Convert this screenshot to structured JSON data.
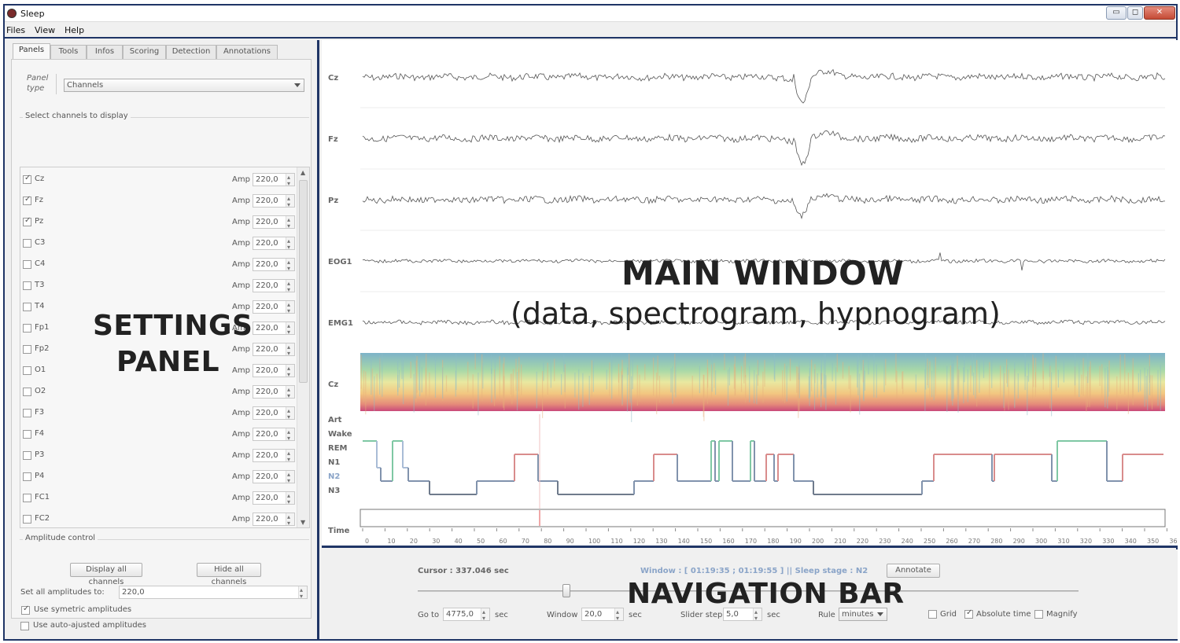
{
  "window": {
    "title": "Sleep",
    "buttons": {
      "minimize": "▭",
      "maximize": "◻",
      "close": "✕"
    }
  },
  "menu": [
    "Files",
    "View",
    "Help"
  ],
  "settings": {
    "tabs": [
      "Panels",
      "Tools",
      "Infos",
      "Scoring",
      "Detection",
      "Annotations"
    ],
    "panel_type_label_1": "Panel",
    "panel_type_label_2": "type",
    "panel_type_value": "Channels",
    "select_channels_title": "Select channels to display",
    "amp_label": "Amp",
    "channels": [
      {
        "name": "Cz",
        "checked": true,
        "amp": "220,0"
      },
      {
        "name": "Fz",
        "checked": true,
        "amp": "220,0"
      },
      {
        "name": "Pz",
        "checked": true,
        "amp": "220,0"
      },
      {
        "name": "C3",
        "checked": false,
        "amp": "220,0"
      },
      {
        "name": "C4",
        "checked": false,
        "amp": "220,0"
      },
      {
        "name": "T3",
        "checked": false,
        "amp": "220,0"
      },
      {
        "name": "T4",
        "checked": false,
        "amp": "220,0"
      },
      {
        "name": "Fp1",
        "checked": false,
        "amp": "220,0"
      },
      {
        "name": "Fp2",
        "checked": false,
        "amp": "220,0"
      },
      {
        "name": "O1",
        "checked": false,
        "amp": "220,0"
      },
      {
        "name": "O2",
        "checked": false,
        "amp": "220,0"
      },
      {
        "name": "F3",
        "checked": false,
        "amp": "220,0"
      },
      {
        "name": "F4",
        "checked": false,
        "amp": "220,0"
      },
      {
        "name": "P3",
        "checked": false,
        "amp": "220,0"
      },
      {
        "name": "P4",
        "checked": false,
        "amp": "220,0"
      },
      {
        "name": "FC1",
        "checked": false,
        "amp": "220,0"
      },
      {
        "name": "FC2",
        "checked": false,
        "amp": "220,0"
      }
    ],
    "amplitude_control_title": "Amplitude control",
    "display_all_label": "Display all channels",
    "hide_all_label": "Hide all channels",
    "set_all_label": "Set all amplitudes to:",
    "set_all_value": "220,0",
    "use_symmetric_label": "Use symetric amplitudes",
    "use_symmetric_checked": true,
    "use_auto_label": "Use auto-ajusted amplitudes",
    "use_auto_checked": false,
    "overlay_line1": "SETTINGS",
    "overlay_line2": "PANEL"
  },
  "main": {
    "channel_labels": [
      "Cz",
      "Fz",
      "Pz",
      "EOG1",
      "EMG1"
    ],
    "spectrogram_label": "Cz",
    "hypno_labels": [
      "Art",
      "Wake",
      "REM",
      "N1",
      "N2",
      "N3"
    ],
    "time_label": "Time",
    "time_ticks": [
      "0",
      "10",
      "20",
      "30",
      "40",
      "50",
      "60",
      "70",
      "80",
      "90",
      "100",
      "110",
      "120",
      "130",
      "140",
      "150",
      "160",
      "170",
      "180",
      "190",
      "200",
      "210",
      "220",
      "230",
      "240",
      "250",
      "260",
      "270",
      "280",
      "290",
      "300",
      "310",
      "320",
      "330",
      "340",
      "350",
      "36"
    ],
    "overlay_title": "MAIN WINDOW",
    "overlay_subtitle": "(data, spectrogram, hypnogram)",
    "colors": {
      "wake": "#7fc8a4",
      "rem": "#d98c8c",
      "n1": "#a9bcd6",
      "n2": "#8193ad",
      "n3": "#6f7b8c",
      "cursor": "#e05050"
    }
  },
  "nav": {
    "cursor_text": "Cursor : 337.046 sec",
    "window_info": "Window : [ 01:19:35 ; 01:19:55 ] || Sleep stage :   N2",
    "annotate_label": "Annotate",
    "goto_label": "Go to",
    "goto_value": "4775,0",
    "goto_unit": "sec",
    "window_label": "Window",
    "window_value": "20,0",
    "window_unit": "sec",
    "slider_step_label": "Slider step",
    "slider_step_value": "5,0",
    "slider_step_unit": "sec",
    "rule_label": "Rule",
    "rule_value": "minutes",
    "grid_label": "Grid",
    "grid_checked": false,
    "abs_time_label": "Absolute time",
    "abs_time_checked": true,
    "magnify_label": "Magnify",
    "magnify_checked": false,
    "overlay_title": "NAVIGATION BAR"
  }
}
